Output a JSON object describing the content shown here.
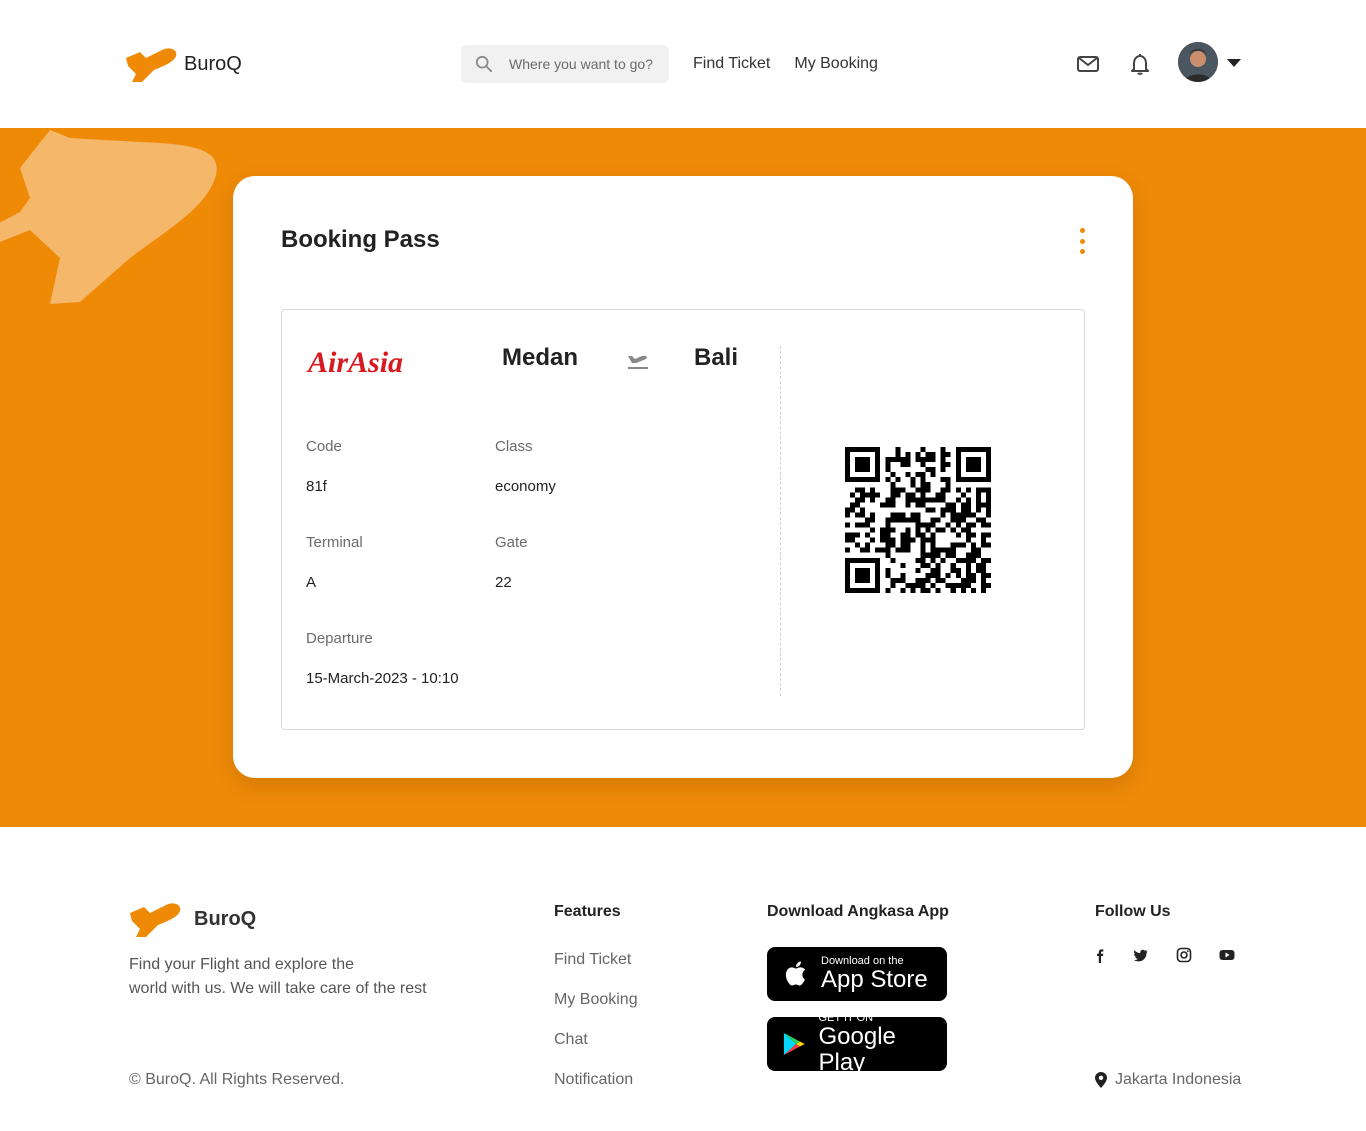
{
  "brand": {
    "name": "BuroQ",
    "accent": "#ef8a07"
  },
  "header": {
    "search_placeholder": "Where you want to go?",
    "nav": [
      "Find Ticket",
      "My Booking"
    ],
    "icons": [
      "mail-icon",
      "bell-icon",
      "avatar",
      "caret-down-icon"
    ]
  },
  "booking": {
    "title": "Booking Pass",
    "airline": "AirAsia",
    "from": "Medan",
    "to": "Bali",
    "fields": {
      "code_label": "Code",
      "code": "81f",
      "class_label": "Class",
      "class": "economy",
      "terminal_label": "Terminal",
      "terminal": "A",
      "gate_label": "Gate",
      "gate": "22",
      "departure_label": "Departure",
      "departure": "15-March-2023 - 10:10"
    }
  },
  "footer": {
    "brand": "BuroQ",
    "tagline_line1": "Find your Flight and explore the",
    "tagline_line2": "world with us. We will take care of the rest",
    "copyright": "© BuroQ. All Rights Reserved.",
    "features_heading": "Features",
    "features": [
      "Find Ticket",
      "My Booking",
      "Chat",
      "Notification"
    ],
    "download_heading": "Download Angkasa App",
    "appstore_small": "Download on the",
    "appstore_big": "App Store",
    "googleplay_small": "GET IT ON",
    "googleplay_big": "Google Play",
    "follow_heading": "Follow Us",
    "socials": [
      "facebook-icon",
      "twitter-icon",
      "instagram-icon",
      "youtube-icon"
    ],
    "location": "Jakarta Indonesia"
  }
}
